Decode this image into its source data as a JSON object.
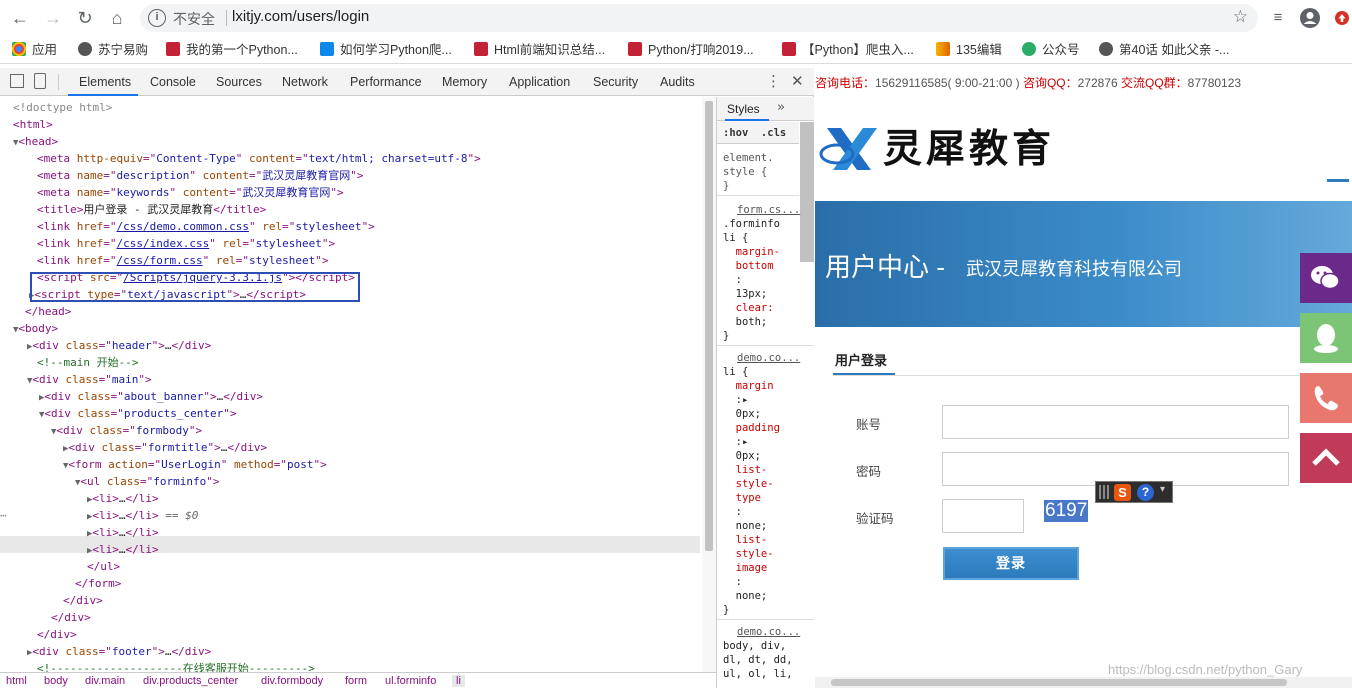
{
  "browser": {
    "security_label": "不安全",
    "url": "lxitjy.com/users/login",
    "bookmarks": [
      {
        "label": "应用",
        "icon": "apps-grid-icon"
      },
      {
        "label": "苏宁易购",
        "icon": "globe-icon"
      },
      {
        "label": "我的第一个Python...",
        "icon": "csdn-icon"
      },
      {
        "label": "如何学习Python爬...",
        "icon": "zhihu-icon"
      },
      {
        "label": "Html前端知识总结...",
        "icon": "csdn-icon"
      },
      {
        "label": "Python/打响2019...",
        "icon": "csdn-icon"
      },
      {
        "label": "【Python】爬虫入...",
        "icon": "csdn-icon"
      },
      {
        "label": "135编辑",
        "icon": "editor-icon"
      },
      {
        "label": "公众号",
        "icon": "wechat-icon"
      },
      {
        "label": "第40话 如此父亲 -...",
        "icon": "globe-icon"
      }
    ]
  },
  "devtools": {
    "tabs": [
      "Elements",
      "Console",
      "Sources",
      "Network",
      "Performance",
      "Memory",
      "Application",
      "Security",
      "Audits"
    ],
    "active_tab": "Elements",
    "selected_suffix": "== $0",
    "styles_tab": "Styles",
    "styles_filter": ":hov  .cls",
    "breadcrumbs": [
      "html",
      "body",
      "div.main",
      "div.products_center",
      "div.formbody",
      "form",
      "ul.forminfo",
      "li"
    ],
    "dom": {
      "doctype": "<!doctype html>",
      "title_text": "用户登录 - 武汉灵犀教育",
      "meta_charset": "text/html; charset=utf-8",
      "meta_desc": "武汉灵犀教育官网",
      "meta_keywords": "武汉灵犀教育官网",
      "css1": "/css/demo.common.css",
      "css2": "/css/index.css",
      "css3": "/css/form.css",
      "js1": "/Scripts/jquery-3.3.1.js",
      "comment_main": "<!--main 开始-->",
      "comment_kf": "<!--------------------在线客服开始--------->",
      "form_action": "UserLogin",
      "form_method": "post"
    },
    "styles": {
      "element_style": [
        "element.",
        "style {",
        "}"
      ],
      "rule1_source": "form.cs...",
      "rule1": [
        ".forminfo",
        "li {",
        "  margin-",
        "  bottom",
        "  :",
        "  13px;",
        "  clear:",
        "  both;",
        "}"
      ],
      "rule2_source": "demo.co...",
      "rule2": [
        "li {",
        "  margin",
        "  :▸",
        "  0px;",
        "  padding",
        "  :▸",
        "  0px;",
        "  list-",
        "  style-",
        "  type",
        "  :",
        "  none;",
        "  list-",
        "  style-",
        "  image",
        "  :",
        "  none;",
        "}"
      ],
      "rule3_source": "demo.co...",
      "rule3": [
        "body, div,",
        "dl, dt, dd,",
        "ul, ol, li,"
      ]
    }
  },
  "site": {
    "contact": {
      "phone_label": "咨询电话：",
      "phone": "15629116585",
      "hours": "( 9:00-21:00 )",
      "qq_label": "咨询QQ：",
      "qq": "272876",
      "group_label": "交流QQ群：",
      "group": "87780123"
    },
    "logo_text": "灵犀教育",
    "banner_title": "用户中心",
    "banner_dash": " - ",
    "banner_sub": "武汉灵犀教育科技有限公司",
    "form_title": "用户登录",
    "labels": {
      "account": "账号",
      "password": "密码",
      "captcha": "验证码"
    },
    "captcha_code": "6197",
    "login_button": "登录",
    "watermark": "https://blog.csdn.net/python_Gary",
    "side_icons": [
      "wechat-icon",
      "qq-icon",
      "phone-icon",
      "back-to-top-icon"
    ],
    "colors": {
      "banner": "#2b7bbd",
      "contact_red": "#cc0000",
      "wechat": "#6b2a8a",
      "qq": "#7cc576",
      "phone": "#e8776e",
      "top": "#c23a5a"
    }
  }
}
